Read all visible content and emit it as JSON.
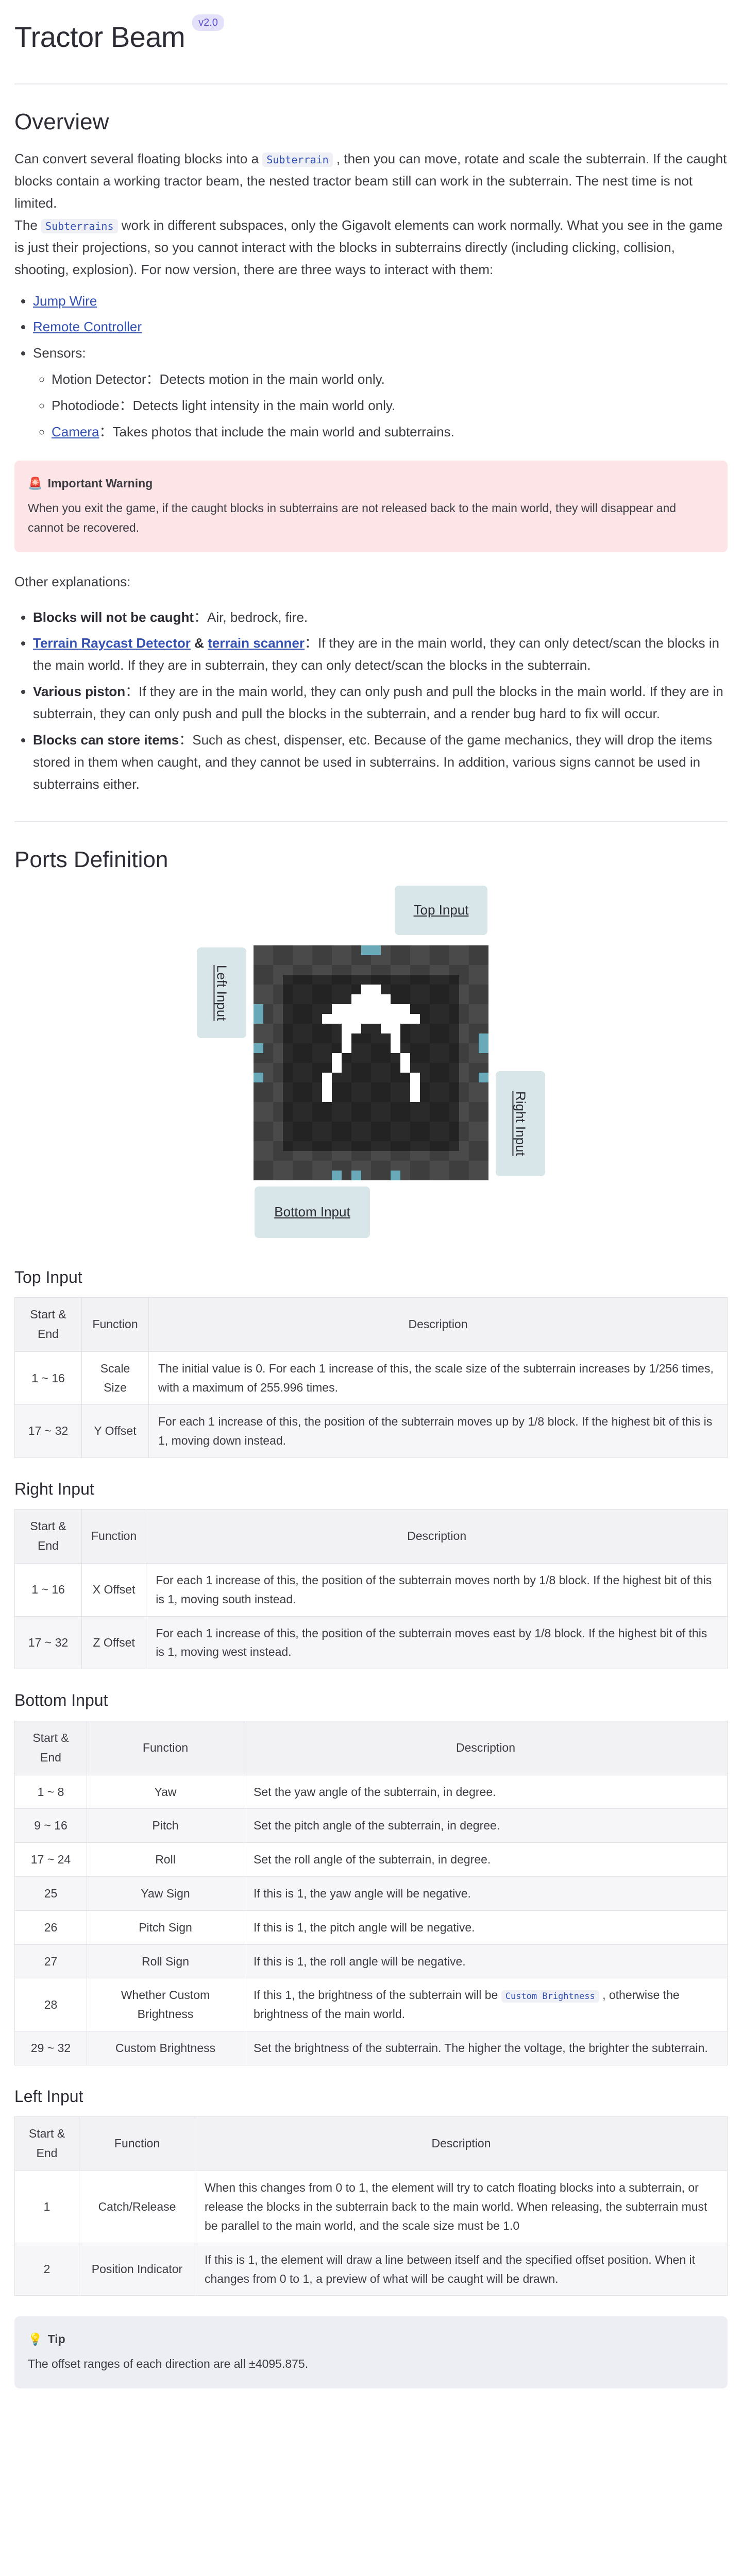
{
  "header": {
    "title": "Tractor Beam",
    "version": "v2.0"
  },
  "overview": {
    "heading": "Overview",
    "p1_before": "Can convert several floating blocks into a",
    "p1_code": "Subterrain",
    "p1_after": ", then you can move, rotate and scale the subterrain. If the caught blocks contain a working tractor beam, the nested tractor beam still can work in the subterrain. The nest time is not limited.",
    "p2_before": "The",
    "p2_code": "Subterrains",
    "p2_after": "work in different subspaces, only the Gigavolt elements can work normally. What you see in the game is just their projections, so you cannot interact with the blocks in subterrains directly (including clicking, collision, shooting, explosion). For now version, there are three ways to interact with them:",
    "ways": {
      "jump_wire": "Jump Wire",
      "remote_controller": "Remote Controller",
      "sensors": "Sensors:",
      "motion_detector": "Motion Detector：Detects motion in the main world only.",
      "photodiode": "Photodiode：Detects light intensity in the main world only.",
      "camera_link": "Camera",
      "camera_text": "：Takes photos that include the main world and subterrains."
    },
    "warning": {
      "icon": "🚨",
      "title": "Important Warning",
      "text": "When you exit the game, if the caught blocks in subterrains are not released back to the main world, they will disappear and cannot be recovered."
    },
    "other_heading": "Other explanations:",
    "explanations": {
      "e1_bold": "Blocks will not be caught",
      "e1_text": "：Air, bedrock, fire.",
      "e2_link1": "Terrain Raycast Detector",
      "e2_amp": " & ",
      "e2_link2": "terrain scanner",
      "e2_text": "：If they are in the main world, they can only detect/scan the blocks in the main world. If they are in subterrain, they can only detect/scan the blocks in the subterrain.",
      "e3_bold": "Various piston",
      "e3_text": "：If they are in the main world, they can only push and pull the blocks in the main world. If they are in subterrain, they can only push and pull the blocks in the subterrain, and a render bug hard to fix will occur.",
      "e4_bold": "Blocks can store items",
      "e4_text": "：Such as chest, dispenser, etc. Because of the game mechanics, they will drop the items stored in them when caught, and they cannot be used in subterrains. In addition, various signs cannot be used in subterrains either."
    }
  },
  "ports": {
    "heading": "Ports Definition",
    "top": "Top Input",
    "left": "Left Input",
    "right": "Right Input",
    "bottom": "Bottom Input"
  },
  "table_headers": {
    "start_end": "Start & End",
    "function": "Function",
    "description": "Description"
  },
  "top_input": {
    "heading": "Top Input",
    "rows": [
      {
        "range": "1 ~ 16",
        "function": "Scale Size",
        "description": "The initial value is 0. For each 1 increase of this, the scale size of the subterrain increases by 1/256 times, with a maximum of 255.996 times."
      },
      {
        "range": "17 ~ 32",
        "function": "Y Offset",
        "description": "For each 1 increase of this, the position of the subterrain moves up by 1/8 block. If the highest bit of this is 1, moving down instead."
      }
    ]
  },
  "right_input": {
    "heading": "Right Input",
    "rows": [
      {
        "range": "1 ~ 16",
        "function": "X Offset",
        "description": "For each 1 increase of this, the position of the subterrain moves north by 1/8 block. If the highest bit of this is 1, moving south instead."
      },
      {
        "range": "17 ~ 32",
        "function": "Z Offset",
        "description": "For each 1 increase of this, the position of the subterrain moves east by 1/8 block. If the highest bit of this is 1, moving west instead."
      }
    ]
  },
  "bottom_input": {
    "heading": "Bottom Input",
    "rows": [
      {
        "range": "1 ~ 8",
        "function": "Yaw",
        "description": "Set the yaw angle of the subterrain, in degree."
      },
      {
        "range": "9 ~ 16",
        "function": "Pitch",
        "description": "Set the pitch angle of the subterrain, in degree."
      },
      {
        "range": "17 ~ 24",
        "function": "Roll",
        "description": "Set the roll angle of the subterrain, in degree."
      },
      {
        "range": "25",
        "function": "Yaw Sign",
        "description": "If this is 1, the yaw angle will be negative."
      },
      {
        "range": "26",
        "function": "Pitch Sign",
        "description": "If this is 1, the pitch angle will be negative."
      },
      {
        "range": "27",
        "function": "Roll Sign",
        "description": "If this is 1, the roll angle will be negative."
      },
      {
        "range": "28",
        "function": "Whether Custom Brightness",
        "desc_before": "If this 1, the brightness of the subterrain will be",
        "desc_code": "Custom Brightness",
        "desc_after": ", otherwise the brightness of the main world."
      },
      {
        "range": "29 ~ 32",
        "function": "Custom Brightness",
        "description": "Set the brightness of the subterrain. The higher the voltage, the brighter the subterrain."
      }
    ]
  },
  "left_input": {
    "heading": "Left Input",
    "rows": [
      {
        "range": "1",
        "function": "Catch/Release",
        "description": "When this changes from 0 to 1, the element will try to catch floating blocks into a subterrain, or release the blocks in the subterrain back to the main world. When releasing, the subterrain must be parallel to the main world, and the scale size must be 1.0"
      },
      {
        "range": "2",
        "function": "Position Indicator",
        "description": "If this is 1, the element will draw a line between itself and the specified offset position. When it changes from 0 to 1, a preview of what will be caught will be drawn."
      }
    ]
  },
  "tip": {
    "icon": "💡",
    "title": "Tip",
    "text": "The offset ranges of each direction are all ±4095.875."
  }
}
